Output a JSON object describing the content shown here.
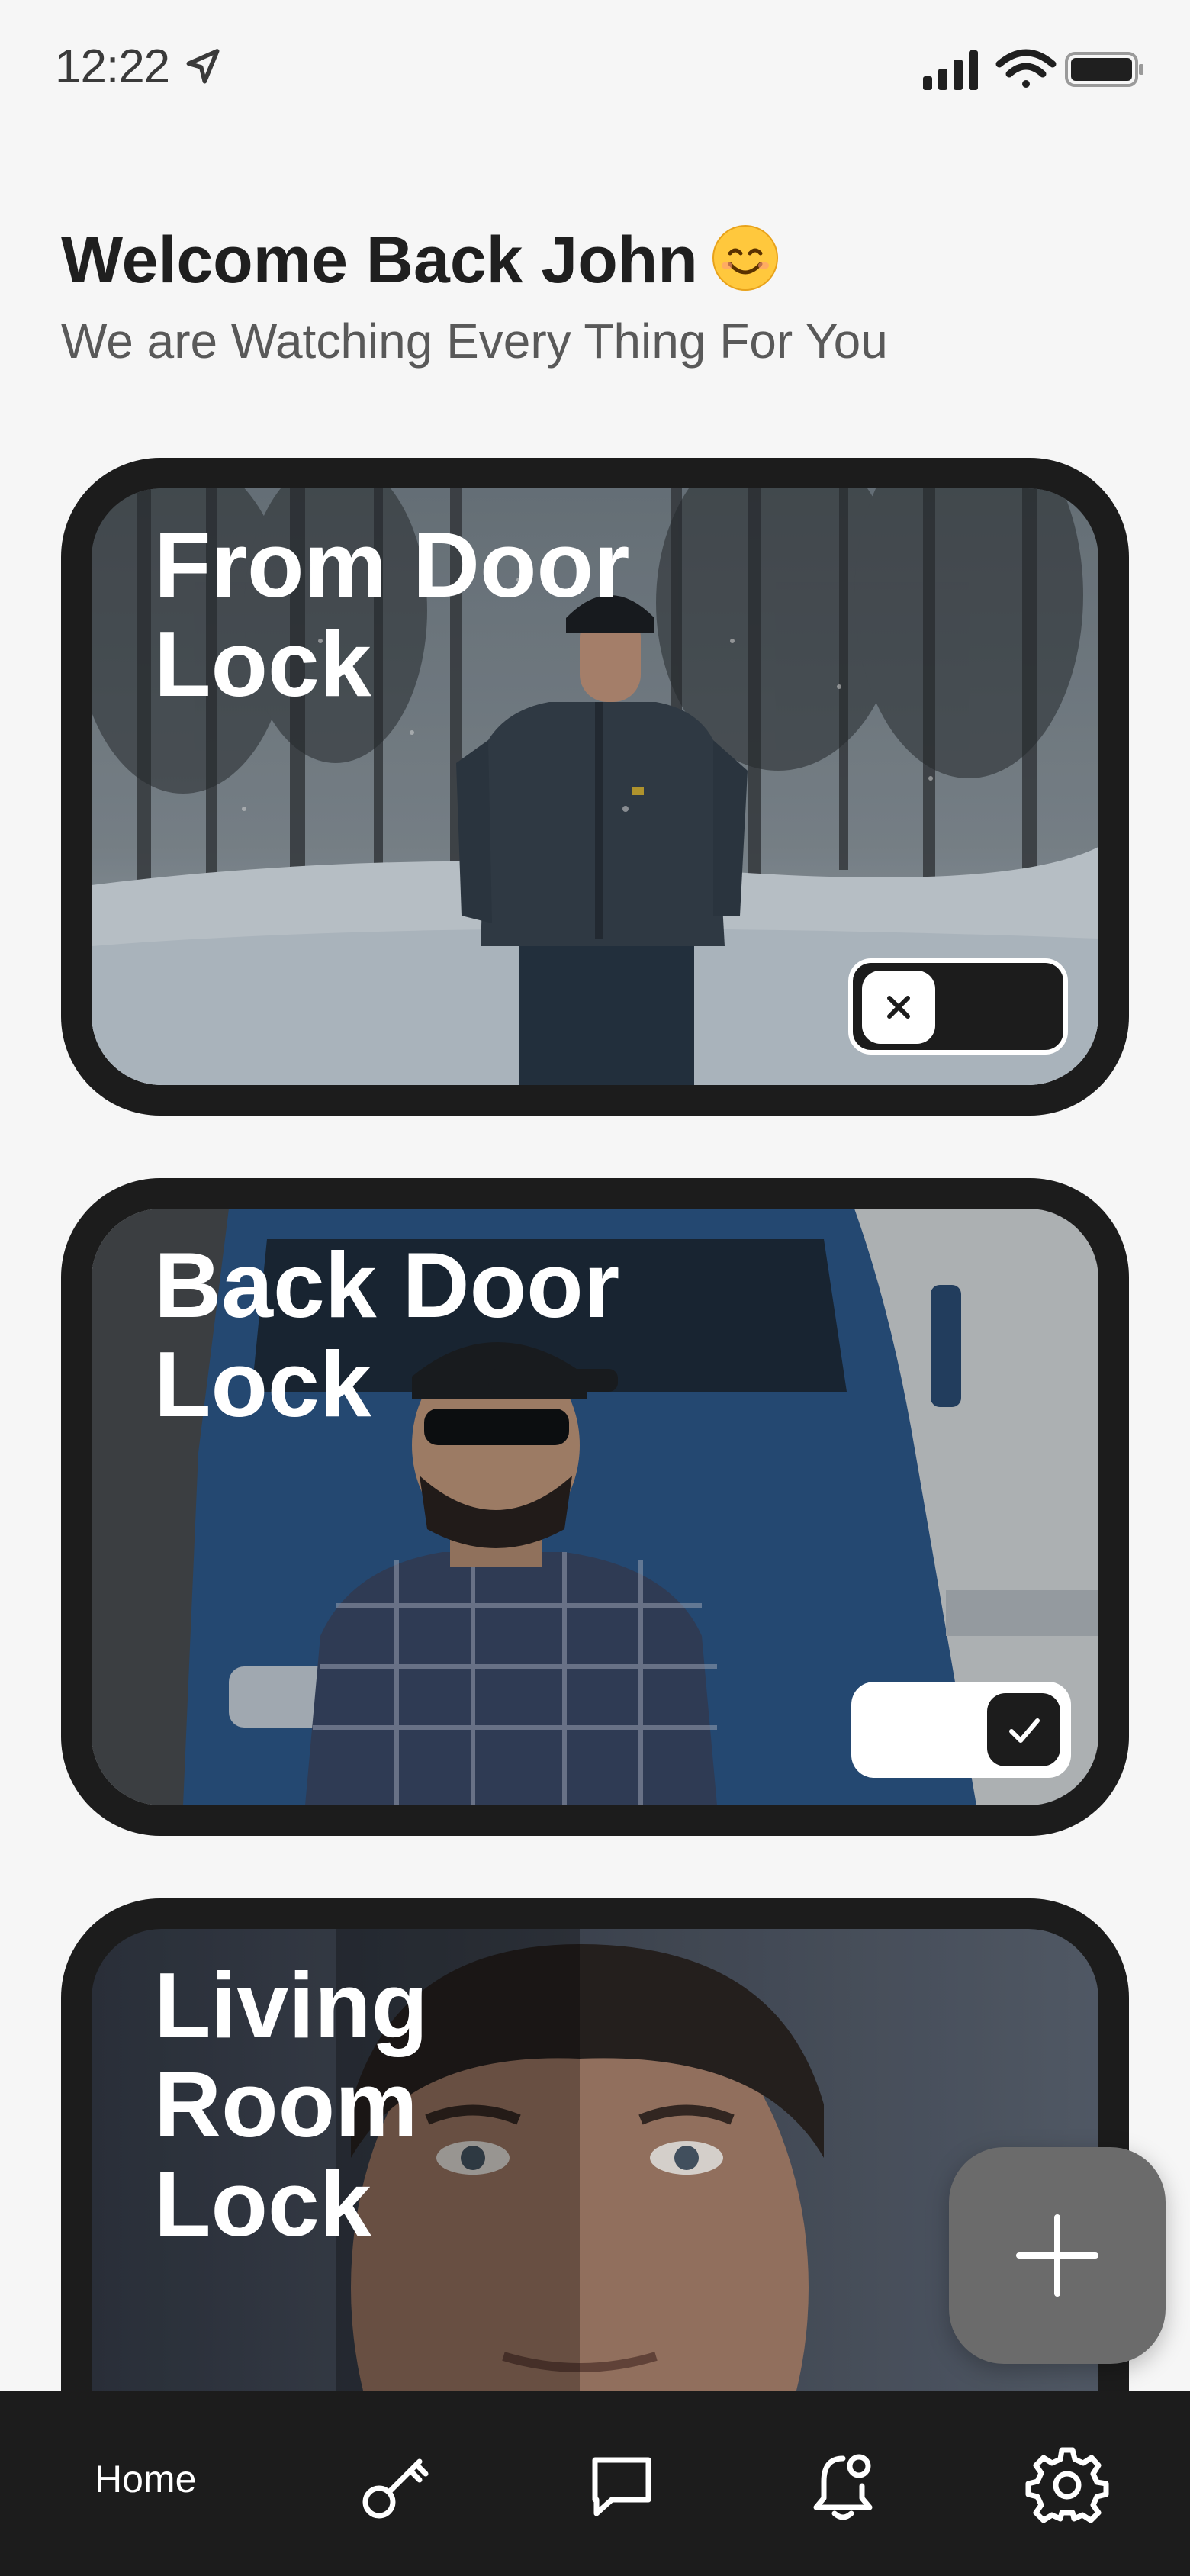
{
  "status_bar": {
    "time": "12:22",
    "icons": [
      "location-arrow-icon",
      "signal-icon",
      "wifi-icon",
      "battery-icon"
    ]
  },
  "header": {
    "title": "Welcome Back John",
    "emoji": "smiling-face-emoji",
    "subtitle": "We are Watching Every Thing For You"
  },
  "locks": [
    {
      "name": "From Door Lock",
      "line1": "From Door",
      "line2": "Lock",
      "state": "off",
      "toggle_icon": "x-icon"
    },
    {
      "name": "Back Door Lock",
      "line1": "Back Door",
      "line2": "Lock",
      "state": "on",
      "toggle_icon": "check-icon"
    },
    {
      "name": "Living Room Lock",
      "line1": "Living",
      "line2": "Room",
      "line3": "Lock"
    }
  ],
  "fab": {
    "icon": "plus-icon"
  },
  "bottom_nav": {
    "home_label": "Home",
    "items": [
      "home",
      "key-icon",
      "chat-icon",
      "bell-icon",
      "gear-icon"
    ]
  },
  "colors": {
    "background": "#f6f6f6",
    "card": "#1c1c1c",
    "nav": "#1c1c1c",
    "fab": "#6b6b6b",
    "text_primary": "#1f1f1f",
    "text_secondary": "#595959"
  }
}
